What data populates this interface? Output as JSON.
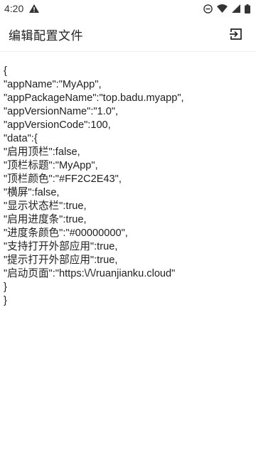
{
  "status_bar": {
    "time": "4:20",
    "icons": [
      "warning-icon",
      "dnd-icon",
      "wifi-icon",
      "signal-icon",
      "battery-icon"
    ]
  },
  "app_bar": {
    "title": "编辑配置文件",
    "action_icon": "exit-to-app-icon"
  },
  "editor": {
    "lines": [
      "{",
      "\"appName\":\"MyApp\",",
      "\"appPackageName\":\"top.badu.myapp\",",
      "\"appVersionName\":\"1.0\",",
      "\"appVersionCode\":100,",
      "\"data\":{",
      "\"启用顶栏\":false,",
      "\"顶栏标题\":\"MyApp\",",
      "\"顶栏颜色\":\"#FF2C2E43\",",
      "\"横屏\":false,",
      "\"显示状态栏\":true,",
      "\"启用进度条\":true,",
      "\"进度条颜色\":\"#00000000\",",
      "\"支持打开外部应用\":true,",
      "\"提示打开外部应用\":true,",
      "\"启动页面\":\"https:\\/\\/ruanjianku.cloud\"",
      "}",
      "}"
    ]
  }
}
